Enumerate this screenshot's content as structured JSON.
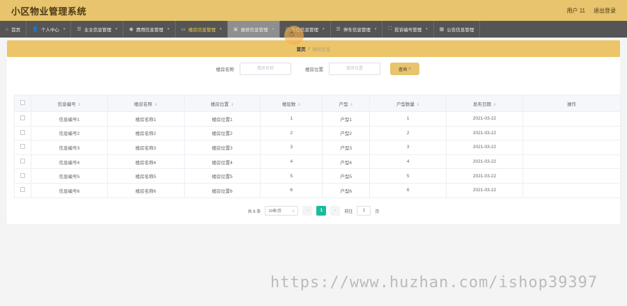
{
  "app": {
    "title": "小区物业管理系统",
    "user": "用户 11",
    "logout": "退出登录"
  },
  "nav": [
    {
      "label": "首页",
      "icon": "home-icon",
      "glyph": "⌂",
      "chevron": false
    },
    {
      "label": "个人中心",
      "icon": "user-icon",
      "glyph": "👤",
      "chevron": true
    },
    {
      "label": "业主信息管理",
      "icon": "list-icon",
      "glyph": "☰",
      "chevron": true
    },
    {
      "label": "费用信息管理",
      "icon": "location-icon",
      "glyph": "◉",
      "chevron": true
    },
    {
      "label": "楼房信息管理",
      "icon": "image-icon",
      "glyph": "▭",
      "chevron": true
    },
    {
      "label": "报修信息管理",
      "icon": "tool-icon",
      "glyph": "▣",
      "chevron": true
    },
    {
      "label": "车位信息管理",
      "icon": "file-icon",
      "glyph": "▯",
      "chevron": true
    },
    {
      "label": "停车信息管理",
      "icon": "doc-icon",
      "glyph": "☰",
      "chevron": true
    },
    {
      "label": "投诉编号管理",
      "icon": "expand-icon",
      "glyph": "⛶",
      "chevron": true
    },
    {
      "label": "公告信息管理",
      "icon": "grid-icon",
      "glyph": "▦",
      "chevron": false
    }
  ],
  "breadcrumb": {
    "home": "首页",
    "separator": "/",
    "current": "楼房信息"
  },
  "search": {
    "name_label": "楼房名称",
    "name_placeholder": "楼房名称",
    "loc_label": "楼房位置",
    "loc_placeholder": "楼房位置",
    "button": "查询"
  },
  "table": {
    "headers": [
      "信息编号",
      "楼房名称",
      "楼房位置",
      "楼层数",
      "户型",
      "户型数量",
      "发布日期",
      "操作"
    ],
    "rows": [
      [
        "信息编号1",
        "楼房名称1",
        "楼房位置1",
        "1",
        "户型1",
        "1",
        "2021-03-22",
        ""
      ],
      [
        "信息编号2",
        "楼房名称2",
        "楼房位置2",
        "2",
        "户型2",
        "2",
        "2021-03-22",
        ""
      ],
      [
        "信息编号3",
        "楼房名称3",
        "楼房位置3",
        "3",
        "户型3",
        "3",
        "2021-03-22",
        ""
      ],
      [
        "信息编号4",
        "楼房名称4",
        "楼房位置4",
        "4",
        "户型4",
        "4",
        "2021-03-22",
        ""
      ],
      [
        "信息编号5",
        "楼房名称5",
        "楼房位置5",
        "5",
        "户型5",
        "5",
        "2021-03-22",
        ""
      ],
      [
        "信息编号6",
        "楼房名称6",
        "楼房位置6",
        "6",
        "户型6",
        "6",
        "2021-03-22",
        ""
      ]
    ]
  },
  "pager": {
    "total": "共 6 条",
    "page_size": "10条/页",
    "current_page": "1",
    "goto_label": "前往",
    "goto_value": "1",
    "page_unit": "页"
  },
  "watermark": "https://www.huzhan.com/ishop39397",
  "colors": {
    "topbar": "#e7c46d",
    "nav": "#555555",
    "active_nav": "#f2c94c",
    "pager_current": "#1abc9c"
  }
}
